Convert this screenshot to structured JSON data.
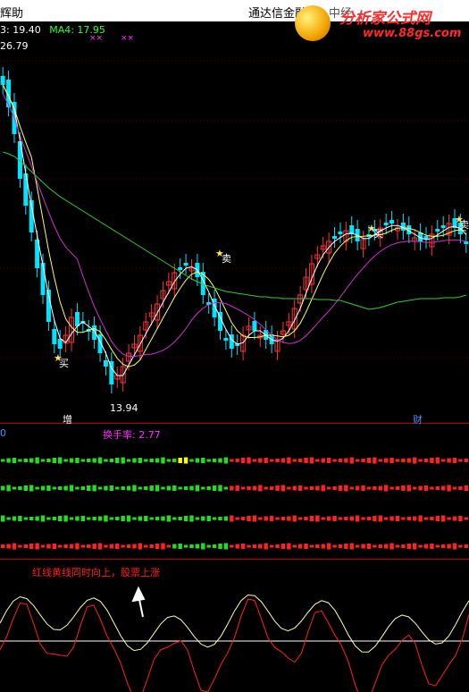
{
  "topbar": {
    "left_text": "辉助",
    "center_text": "通达信金融",
    "right_text": "中经"
  },
  "logo": {
    "title": "分析家公式网",
    "url": "www.88gs.com"
  },
  "indicators": {
    "ma3_label": "3: 19.40",
    "ma4_label": "MA4: 17.95",
    "marker_glyph": "××"
  },
  "price_labels": {
    "high": "26.79",
    "low": "13.94"
  },
  "signals": {
    "buy": "买",
    "sell": "卖"
  },
  "tags": {
    "zeng": "增",
    "cai": "财"
  },
  "sub_panel": {
    "zero_label": "0",
    "turnover_label": "换手率: 2.77"
  },
  "note": "红线黄线同时向上，股票上涨",
  "colors": {
    "up": "#ff3333",
    "down": "#00e5ff",
    "ma_white": "#ffffff",
    "ma_yellow": "#ffff66",
    "ma_magenta": "#cc33cc",
    "ma_green": "#33cc33",
    "divider": "#b00000"
  }
}
